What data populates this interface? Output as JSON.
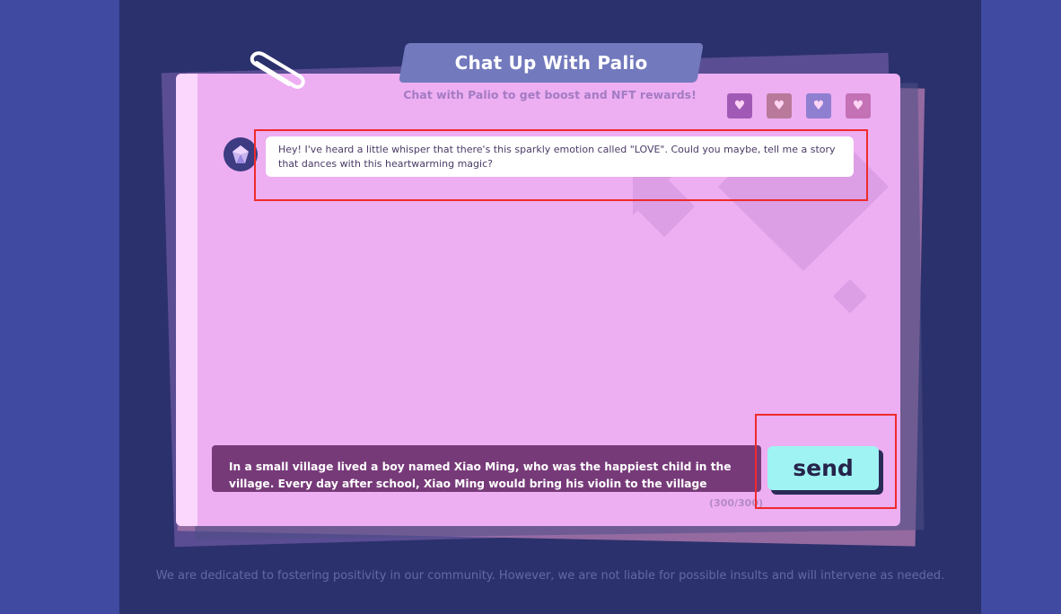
{
  "header": {
    "title": "Chat Up With Palio",
    "subtitle": "Chat with Palio to get boost and NFT rewards!"
  },
  "rewards": [
    {
      "icon": "heart-gem-icon"
    },
    {
      "icon": "heart-lips-icon"
    },
    {
      "icon": "heart-bubble-icon"
    },
    {
      "icon": "heart-arrow-icon"
    }
  ],
  "chat": {
    "messages": [
      {
        "sender": "palio",
        "avatar_icon": "gem-avatar-icon",
        "text": "Hey! I've heard a little whisper that there's this sparkly emotion called \"LOVE\". Could you maybe, tell me a story that dances with this heartwarming magic?"
      }
    ]
  },
  "composer": {
    "value": "In a small village lived a boy named Xiao Ming, who was the happiest child in the village. Every day after school, Xiao Ming would bring his violin to the village square.",
    "counter": "(300/300)",
    "send_label": "send"
  },
  "footer": {
    "text": "We are dedicated to fostering positivity in our community. However, we are not liable for possible insults and will intervene as needed."
  },
  "colors": {
    "page_bg": "#3f4aa0",
    "panel_bg": "#2b316c",
    "card_bg": "#edaef2",
    "title_tab": "#7279bd",
    "input_bg": "#773a79",
    "send_bg": "#9ff3f3",
    "highlight": "#ef2b2b"
  }
}
